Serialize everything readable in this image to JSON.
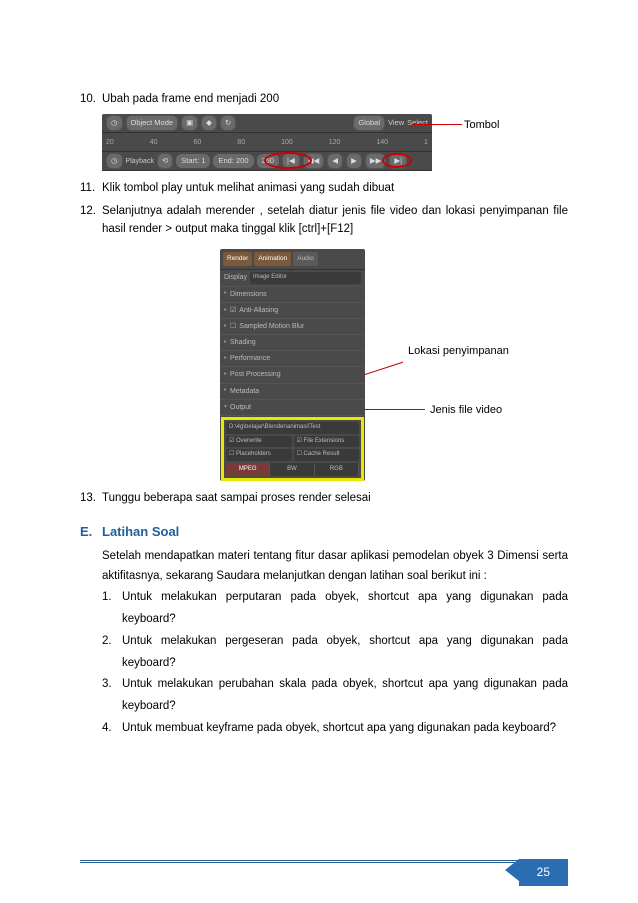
{
  "steps": {
    "s10": {
      "num": "10.",
      "text": "Ubah pada frame end menjadi 200"
    },
    "s11": {
      "num": "11.",
      "text": "Klik tombol play untuk melihat animasi yang sudah dibuat"
    },
    "s12": {
      "num": "12.",
      "text": "Selanjutnya adalah merender , setelah diatur jenis file video dan lokasi penyimpanan file hasil render > output maka tinggal klik [ctrl]+[F12]"
    },
    "s13": {
      "num": "13.",
      "text": "Tunggu beberapa saat sampai proses render selesai"
    }
  },
  "timeline": {
    "mode": "Object Mode",
    "right1": "Global",
    "right2": "View",
    "right3": "Select",
    "ticks": [
      "20",
      "40",
      "60",
      "80",
      "100",
      "120",
      "140",
      "1"
    ],
    "playback": "Playback",
    "start_label": "Start:",
    "start_val": "1",
    "end_label": "End:",
    "end_val": "200",
    "frame_val": "250",
    "annot_tombol": "Tombol"
  },
  "render": {
    "render_label": "Render",
    "animation_label": "Animation",
    "audio_label": "Audio",
    "display": "Display",
    "image_editor": "Image Editor",
    "dimensions": "Dimensions",
    "anti_aliasing": "Anti-Aliasing",
    "sampled_motion_blur": "Sampled Motion Blur",
    "shading": "Shading",
    "performance": "Performance",
    "post_processing": "Post Processing",
    "metadata": "Metadata",
    "output": "Output",
    "path": "D:\\4g\\belajar\\Blender\\animasi\\Test",
    "overwrite": "Overwrite",
    "file_ext": "File Extensions",
    "placeholders": "Placeholders",
    "cache_result": "Cache Result",
    "mpeg": "MPEG",
    "bw": "BW",
    "rgb": "RGB",
    "annot_lokasi": "Lokasi penyimpanan",
    "annot_jenis": "Jenis file video"
  },
  "section": {
    "letter": "E.",
    "title": "Latihan Soal",
    "intro": "Setelah mendapatkan materi tentang fitur dasar aplikasi pemodelan obyek 3 Dimensi serta aktifitasnya, sekarang Saudara melanjutkan dengan latihan soal berikut ini :"
  },
  "questions": {
    "q1": {
      "num": "1.",
      "text": "Untuk melakukan perputaran pada obyek, shortcut apa yang digunakan pada keyboard?"
    },
    "q2": {
      "num": "2.",
      "text": "Untuk melakukan pergeseran pada obyek, shortcut apa yang digunakan pada keyboard?"
    },
    "q3": {
      "num": "3.",
      "text": "Untuk melakukan perubahan skala pada obyek, shortcut apa yang digunakan pada keyboard?"
    },
    "q4": {
      "num": "4.",
      "text": "Untuk membuat keyframe pada obyek, shortcut apa yang digunakan pada keyboard?"
    }
  },
  "page_number": "25"
}
